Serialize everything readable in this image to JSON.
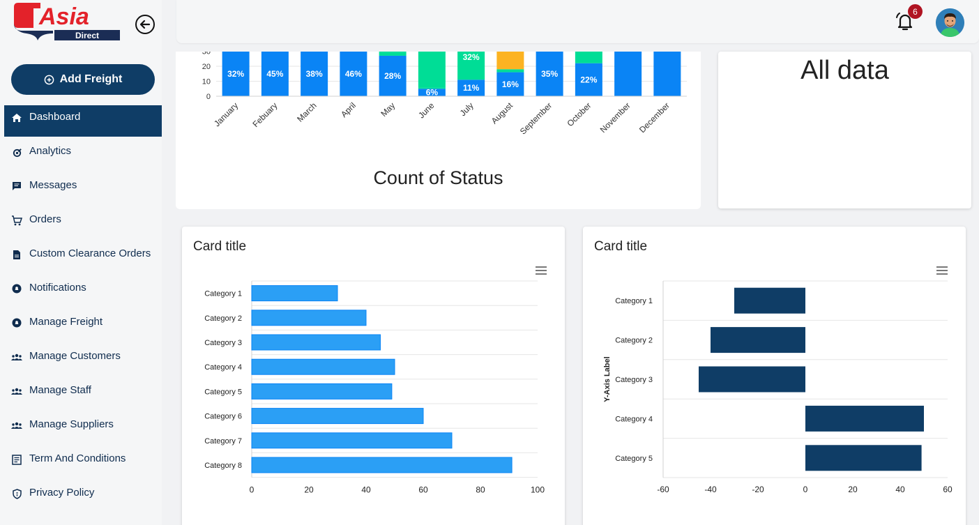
{
  "brand": {
    "name": "Asia",
    "sub": "Direct"
  },
  "sidebar": {
    "add_button": "Add Freight",
    "items": [
      {
        "label": "Dashboard",
        "icon": "home-icon"
      },
      {
        "label": "Analytics",
        "icon": "analytics-icon"
      },
      {
        "label": "Messages",
        "icon": "message-icon"
      },
      {
        "label": "Orders",
        "icon": "cart-icon"
      },
      {
        "label": "Custom Clearance Orders",
        "icon": "document-icon"
      },
      {
        "label": "Notifications",
        "icon": "notification-icon"
      },
      {
        "label": "Manage Freight",
        "icon": "freight-icon"
      },
      {
        "label": "Manage Customers",
        "icon": "group-icon"
      },
      {
        "label": "Manage Staff",
        "icon": "group-icon"
      },
      {
        "label": "Manage Suppliers",
        "icon": "group-icon"
      },
      {
        "label": "Term And Conditions",
        "icon": "list-icon"
      },
      {
        "label": "Privacy Policy",
        "icon": "shield-icon"
      }
    ]
  },
  "header": {
    "notification_count": "6"
  },
  "top_cards": {
    "chart_caption": "Count of Status",
    "all_data": "All data"
  },
  "cards": {
    "left_title": "Card title",
    "right_title": "Card title"
  },
  "colors": {
    "navy": "#0f3d66",
    "blue": "#0a84f5",
    "green": "#00dd96",
    "orange": "#fcb322",
    "bar_blue": "#2b9ff5",
    "bar_navy": "#0f3d66"
  },
  "chart_data": [
    {
      "type": "bar",
      "stacked": true,
      "categories": [
        "January",
        "Febuary",
        "March",
        "April",
        "May",
        "June",
        "July",
        "August",
        "September",
        "October",
        "November",
        "December"
      ],
      "y_ticks": [
        "0",
        "10",
        "20",
        "30"
      ],
      "ylim": [
        0,
        30
      ],
      "series": [
        {
          "values": [
            30,
            30,
            30,
            30,
            27,
            5,
            11,
            16,
            30,
            22,
            30,
            30
          ]
        },
        {
          "values": [
            0,
            0,
            0,
            0,
            2,
            1,
            0,
            2,
            0,
            0,
            0,
            0
          ]
        },
        {
          "values": [
            0,
            0,
            0,
            0,
            1,
            24,
            19,
            0,
            0,
            8,
            0,
            0
          ]
        },
        {
          "values": [
            0,
            0,
            0,
            0,
            0,
            0,
            0,
            12,
            0,
            0,
            0,
            0
          ]
        }
      ],
      "data_labels": [
        "32%",
        "45%",
        "38%",
        "46%",
        "28%",
        "6%",
        "11%",
        "16%",
        "35%",
        "22%",
        "",
        ""
      ],
      "top_labels": [
        "",
        "",
        "",
        "",
        "",
        "",
        "32%",
        "",
        "",
        "",
        "",
        ""
      ]
    },
    {
      "type": "bar",
      "orientation": "horizontal",
      "categories": [
        "Category 1",
        "Category 2",
        "Category 3",
        "Category 4",
        "Category 5",
        "Category 6",
        "Category 7",
        "Category 8"
      ],
      "values": [
        30,
        40,
        45,
        50,
        49,
        60,
        70,
        91
      ],
      "x_ticks": [
        "0",
        "20",
        "40",
        "60",
        "80",
        "100"
      ],
      "xlim": [
        0,
        100
      ]
    },
    {
      "type": "bar",
      "orientation": "horizontal",
      "categories": [
        "Category 1",
        "Category 2",
        "Category 3",
        "Category 4",
        "Category 5"
      ],
      "values": [
        -30,
        -40,
        -45,
        50,
        49
      ],
      "x_ticks": [
        "-60",
        "-40",
        "-20",
        "0",
        "20",
        "40",
        "60"
      ],
      "xlim": [
        -60,
        60
      ],
      "ylabel": "Y-Axis Label"
    }
  ]
}
